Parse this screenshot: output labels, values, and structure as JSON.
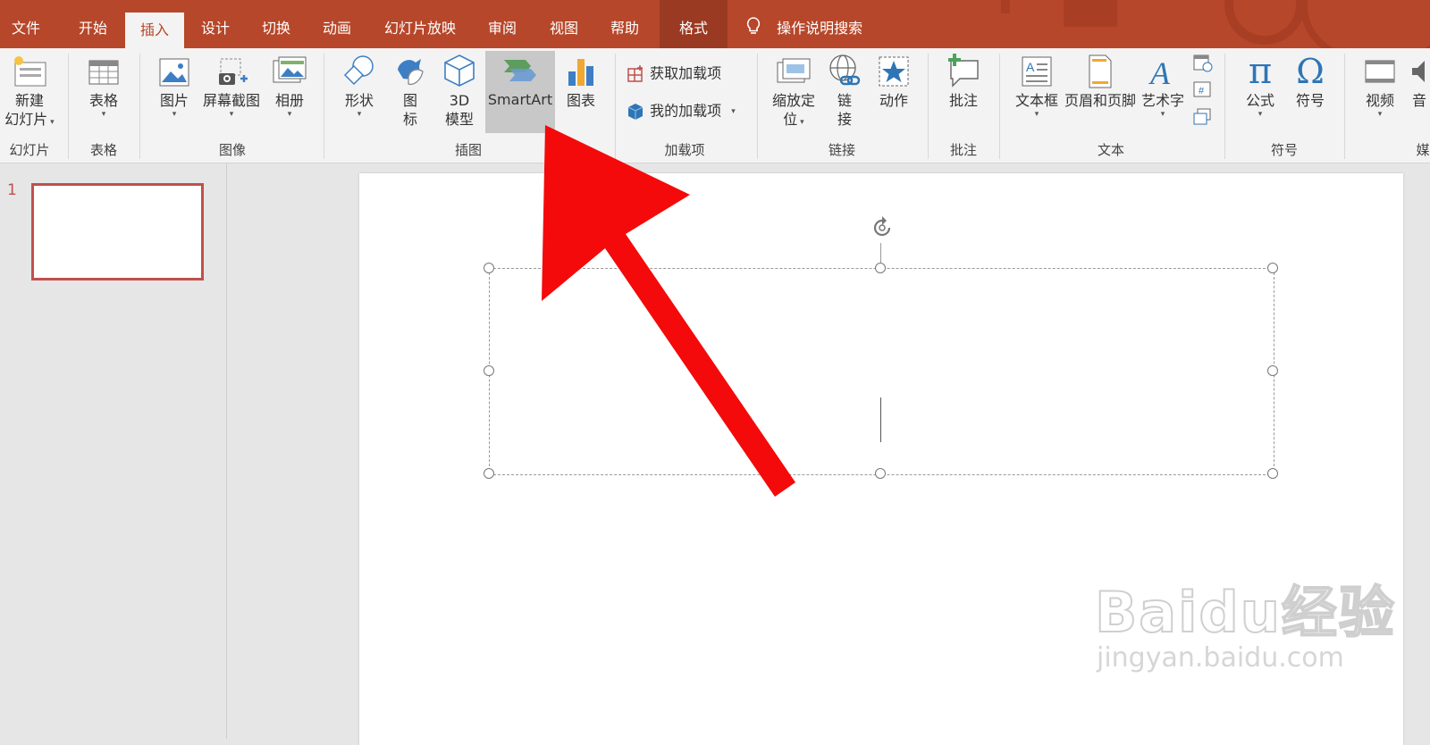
{
  "tabs": [
    {
      "label": "文件",
      "key": "file"
    },
    {
      "label": "开始",
      "key": "home"
    },
    {
      "label": "插入",
      "key": "insert"
    },
    {
      "label": "设计",
      "key": "design"
    },
    {
      "label": "切换",
      "key": "transitions"
    },
    {
      "label": "动画",
      "key": "animations"
    },
    {
      "label": "幻灯片放映",
      "key": "slideshow"
    },
    {
      "label": "审阅",
      "key": "review"
    },
    {
      "label": "视图",
      "key": "view"
    },
    {
      "label": "帮助",
      "key": "help"
    },
    {
      "label": "格式",
      "key": "format"
    }
  ],
  "active_tab": "插入",
  "search": {
    "label": "操作说明搜索",
    "icon": "lightbulb-icon"
  },
  "ribbon": {
    "slides": {
      "new_slide_line1": "新建",
      "new_slide_line2": "幻灯片",
      "group": "幻灯片"
    },
    "tables": {
      "table": "表格",
      "group": "表格"
    },
    "images": {
      "picture": "图片",
      "screenshot": "屏幕截图",
      "album": "相册",
      "group": "图像"
    },
    "illustrations": {
      "shapes": "形状",
      "icons_line1": "图",
      "icons_line2": "标",
      "model_line1": "3D",
      "model_line2": "模型",
      "smartart": "SmartArt",
      "chart": "图表",
      "group": "插图"
    },
    "addins": {
      "get_addins": "获取加载项",
      "my_addins": "我的加载项",
      "group": "加载项"
    },
    "links": {
      "zoom_line1": "缩放定",
      "zoom_line2": "位",
      "link_line1": "链",
      "link_line2": "接",
      "action": "动作",
      "group": "链接"
    },
    "comments": {
      "comment": "批注",
      "group": "批注"
    },
    "text": {
      "textbox": "文本框",
      "header_footer": "页眉和页脚",
      "wordart": "艺术字",
      "group": "文本"
    },
    "symbols": {
      "equation": "公式",
      "symbol": "符号",
      "group": "符号"
    },
    "media": {
      "video": "视频",
      "audio": "音",
      "group": "媒"
    }
  },
  "slides_panel": {
    "slide_number": "1"
  },
  "watermark": {
    "brand": "Baidu经验",
    "url": "jingyan.baidu.com"
  },
  "colors": {
    "accent": "#b7472a",
    "arrow": "#f40a0a",
    "ribbon_bg": "#f3f3f3"
  }
}
